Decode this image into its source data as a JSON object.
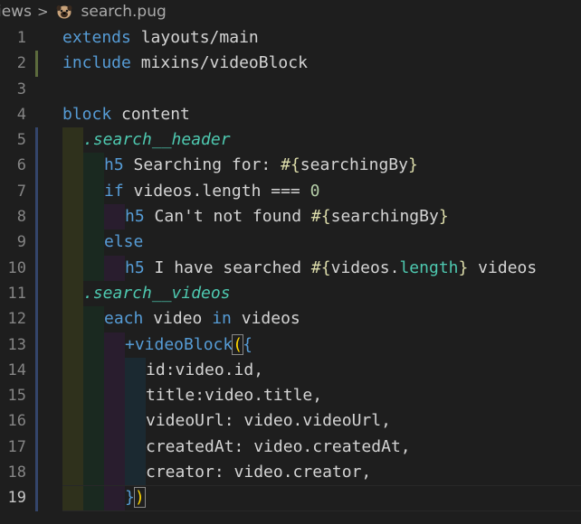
{
  "breadcrumb": {
    "folder": "iews",
    "separator": ">",
    "file": "search.pug",
    "file_icon": "pug-dog-icon"
  },
  "colors": {
    "background": "#1e1e1e",
    "keyword": "#569cd6",
    "class": "#4ec9b0",
    "number": "#b5cea8",
    "mixin": "#dcdcaa",
    "text": "#d4d4d4",
    "line_number": "#858585",
    "bracket": "#ffd700"
  },
  "lines": [
    {
      "n": "1",
      "mod": "",
      "tokens": [
        {
          "t": "extends",
          "c": "kw"
        },
        {
          "t": " layouts/main",
          "c": "txt"
        }
      ]
    },
    {
      "n": "2",
      "mod": "modified",
      "tokens": [
        {
          "t": "include",
          "c": "kw"
        },
        {
          "t": " mixins/videoBlock",
          "c": "txt"
        }
      ]
    },
    {
      "n": "3",
      "mod": "",
      "tokens": []
    },
    {
      "n": "4",
      "mod": "",
      "tokens": [
        {
          "t": "block",
          "c": "kw"
        },
        {
          "t": " content",
          "c": "txt"
        }
      ]
    },
    {
      "n": "5",
      "mod": "added",
      "tokens": [
        {
          "t": ".search__header",
          "c": "cls"
        }
      ]
    },
    {
      "n": "6",
      "mod": "added",
      "tokens": [
        {
          "t": "h5",
          "c": "tag"
        },
        {
          "t": " Searching for: ",
          "c": "txt"
        },
        {
          "t": "#{",
          "c": "interp"
        },
        {
          "t": "searchingBy",
          "c": "txt"
        },
        {
          "t": "}",
          "c": "interp"
        }
      ]
    },
    {
      "n": "7",
      "mod": "added",
      "tokens": [
        {
          "t": "if",
          "c": "kw"
        },
        {
          "t": " videos.length ",
          "c": "txt"
        },
        {
          "t": "===",
          "c": "txt"
        },
        {
          "t": " ",
          "c": "txt"
        },
        {
          "t": "0",
          "c": "num"
        }
      ]
    },
    {
      "n": "8",
      "mod": "added",
      "tokens": [
        {
          "t": "h5",
          "c": "tag"
        },
        {
          "t": " Can't not found ",
          "c": "txt"
        },
        {
          "t": "#{",
          "c": "interp"
        },
        {
          "t": "searchingBy",
          "c": "txt"
        },
        {
          "t": "}",
          "c": "interp"
        }
      ]
    },
    {
      "n": "9",
      "mod": "added",
      "tokens": [
        {
          "t": "else",
          "c": "kw"
        }
      ]
    },
    {
      "n": "10",
      "mod": "added",
      "tokens": [
        {
          "t": "h5",
          "c": "tag"
        },
        {
          "t": " I have searched ",
          "c": "txt"
        },
        {
          "t": "#{",
          "c": "interp"
        },
        {
          "t": "videos.",
          "c": "txt"
        },
        {
          "t": "length",
          "c": "prop"
        },
        {
          "t": "}",
          "c": "interp"
        },
        {
          "t": " videos",
          "c": "txt"
        }
      ]
    },
    {
      "n": "11",
      "mod": "added",
      "tokens": [
        {
          "t": ".search__videos",
          "c": "cls"
        }
      ]
    },
    {
      "n": "12",
      "mod": "added",
      "tokens": [
        {
          "t": "each",
          "c": "kw"
        },
        {
          "t": " video ",
          "c": "txt"
        },
        {
          "t": "in",
          "c": "kw"
        },
        {
          "t": " videos",
          "c": "txt"
        }
      ]
    },
    {
      "n": "13",
      "mod": "added",
      "tokens": [
        {
          "t": "+videoBlock",
          "c": "kw"
        },
        {
          "t": "(",
          "c": "bracket-match"
        },
        {
          "t": "{",
          "c": "kw"
        }
      ]
    },
    {
      "n": "14",
      "mod": "added",
      "tokens": [
        {
          "t": "id",
          "c": "txt"
        },
        {
          "t": ":",
          "c": "txt"
        },
        {
          "t": "video.id,",
          "c": "txt"
        }
      ]
    },
    {
      "n": "15",
      "mod": "added",
      "tokens": [
        {
          "t": "title",
          "c": "txt"
        },
        {
          "t": ":",
          "c": "txt"
        },
        {
          "t": "video.title,",
          "c": "txt"
        }
      ]
    },
    {
      "n": "16",
      "mod": "added",
      "tokens": [
        {
          "t": "videoUrl",
          "c": "txt"
        },
        {
          "t": ": video.videoUrl,",
          "c": "txt"
        }
      ]
    },
    {
      "n": "17",
      "mod": "added",
      "tokens": [
        {
          "t": "createdAt",
          "c": "txt"
        },
        {
          "t": ": video.createdAt,",
          "c": "txt"
        }
      ]
    },
    {
      "n": "18",
      "mod": "added",
      "tokens": [
        {
          "t": "creator",
          "c": "txt"
        },
        {
          "t": ": video.creator,",
          "c": "txt"
        }
      ]
    },
    {
      "n": "19",
      "mod": "added",
      "tokens": [
        {
          "t": "}",
          "c": "kw"
        },
        {
          "t": ")",
          "c": "bracket-match"
        }
      ]
    }
  ]
}
